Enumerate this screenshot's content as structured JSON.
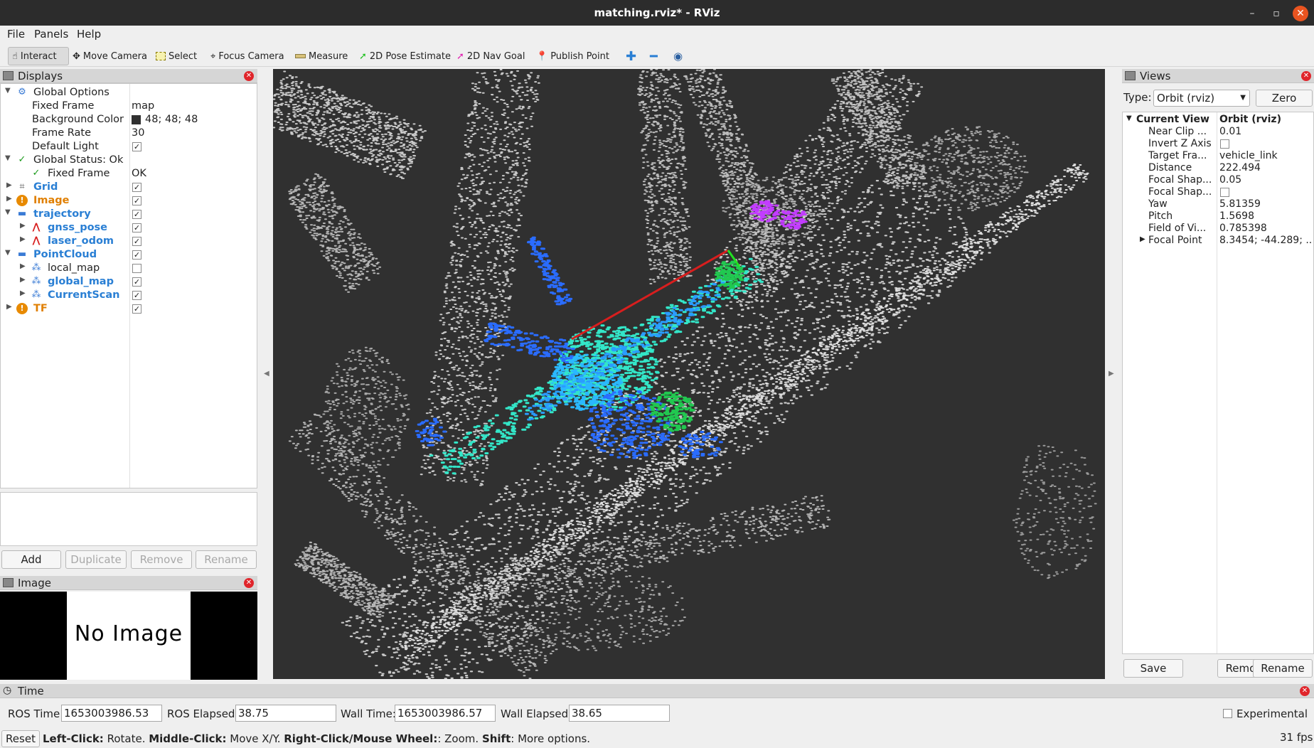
{
  "window": {
    "title": "matching.rviz* - RViz",
    "minimize": "–",
    "maximize": "▫",
    "close": "✕"
  },
  "menu": [
    "File",
    "Panels",
    "Help"
  ],
  "toolbar": {
    "interact": "Interact",
    "move_camera": "Move Camera",
    "select": "Select",
    "focus_camera": "Focus Camera",
    "measure": "Measure",
    "pose_estimate": "2D Pose Estimate",
    "nav_goal": "2D Nav Goal",
    "publish_point": "Publish Point"
  },
  "displays": {
    "title": "Displays",
    "rows": [
      {
        "name": "Global Options",
        "value": ""
      },
      {
        "name": "Fixed Frame",
        "value": "map"
      },
      {
        "name": "Background Color",
        "value": "48; 48; 48"
      },
      {
        "name": "Frame Rate",
        "value": "30"
      },
      {
        "name": "Default Light",
        "value": ""
      },
      {
        "name": "Global Status: Ok",
        "value": ""
      },
      {
        "name": "Fixed Frame",
        "value": "OK"
      },
      {
        "name": "Grid",
        "value": ""
      },
      {
        "name": "Image",
        "value": ""
      },
      {
        "name": "trajectory",
        "value": ""
      },
      {
        "name": "gnss_pose",
        "value": ""
      },
      {
        "name": "laser_odom",
        "value": ""
      },
      {
        "name": "PointCloud",
        "value": ""
      },
      {
        "name": "local_map",
        "value": ""
      },
      {
        "name": "global_map",
        "value": ""
      },
      {
        "name": "CurrentScan",
        "value": ""
      },
      {
        "name": "TF",
        "value": ""
      }
    ],
    "buttons": {
      "add": "Add",
      "duplicate": "Duplicate",
      "remove": "Remove",
      "rename": "Rename"
    }
  },
  "image_panel": {
    "title": "Image",
    "placeholder": "No Image"
  },
  "views": {
    "title": "Views",
    "type_label": "Type:",
    "type_value": "Orbit (rviz)",
    "zero": "Zero",
    "rows": [
      {
        "name": "Current View",
        "value": "Orbit (rviz)"
      },
      {
        "name": "Near Clip ...",
        "value": "0.01"
      },
      {
        "name": "Invert Z Axis",
        "value": ""
      },
      {
        "name": "Target Fra...",
        "value": "vehicle_link"
      },
      {
        "name": "Distance",
        "value": "222.494"
      },
      {
        "name": "Focal Shap...",
        "value": "0.05"
      },
      {
        "name": "Focal Shap...",
        "value": ""
      },
      {
        "name": "Yaw",
        "value": "5.81359"
      },
      {
        "name": "Pitch",
        "value": "1.5698"
      },
      {
        "name": "Field of Vi...",
        "value": "0.785398"
      },
      {
        "name": "Focal Point",
        "value": "8.3454; -44.289; ..."
      }
    ],
    "buttons": {
      "save": "Save",
      "remove": "Remove",
      "rename": "Rename"
    }
  },
  "time": {
    "title": "Time",
    "ros_time_label": "ROS Time:",
    "ros_time": "1653003986.53",
    "ros_elapsed_label": "ROS Elapsed:",
    "ros_elapsed": "38.75",
    "wall_time_label": "Wall Time:",
    "wall_time": "1653003986.57",
    "wall_elapsed_label": "Wall Elapsed:",
    "wall_elapsed": "38.65",
    "experimental": "Experimental"
  },
  "status": {
    "reset": "Reset",
    "left_key": "Left-Click:",
    "left_txt": " Rotate. ",
    "middle_key": "Middle-Click:",
    "middle_txt": " Move X/Y. ",
    "right_key": "Right-Click/Mouse Wheel:",
    "right_txt": ": Zoom. ",
    "shift_key": "Shift",
    "shift_txt": ": More options.",
    "fps": "31 fps"
  },
  "colors": {
    "viewport_bg": "#303030",
    "trajectory": "#d81e1e",
    "scan_cyan": "#33e6c8",
    "scan_blue": "#2a6cff"
  }
}
